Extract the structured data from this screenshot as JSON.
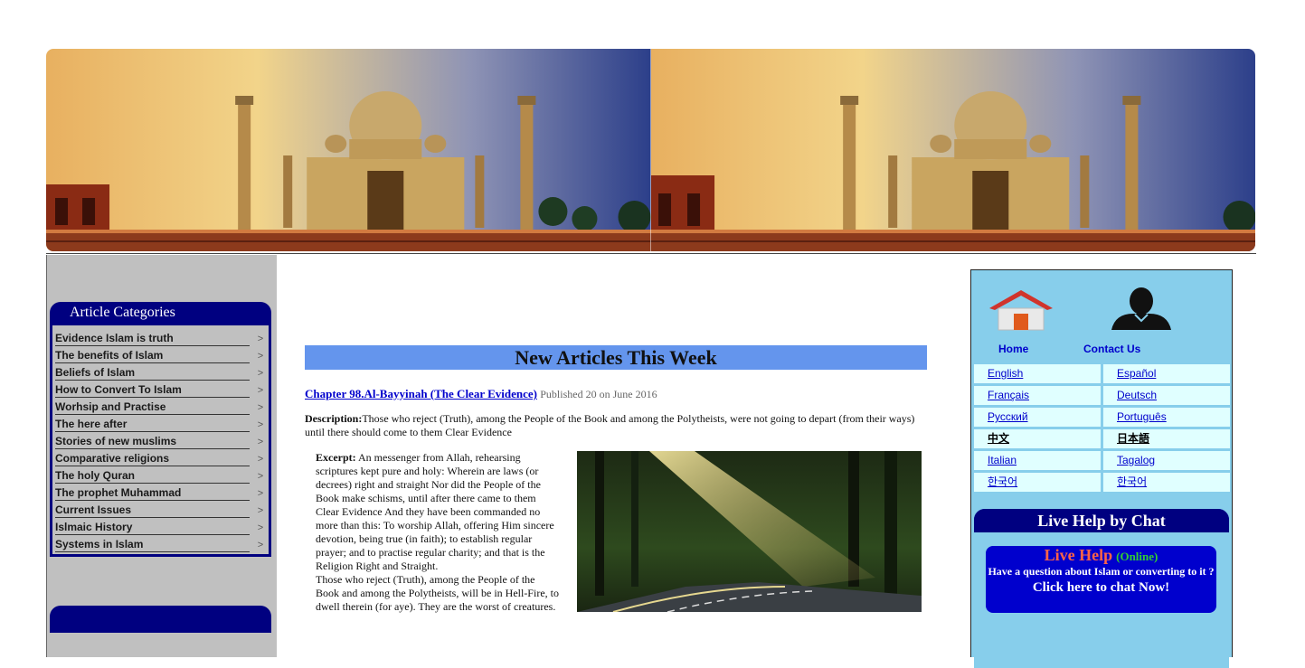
{
  "left_categories": {
    "title": "Article Categories",
    "items": [
      {
        "label": "Evidence Islam is truth"
      },
      {
        "label": "The benefits of Islam"
      },
      {
        "label": "Beliefs of Islam"
      },
      {
        "label": "How to Convert To Islam"
      },
      {
        "label": "Worhsip and Practise"
      },
      {
        "label": "The here after"
      },
      {
        "label": "Stories of new muslims"
      },
      {
        "label": "Comparative religions"
      },
      {
        "label": "The holy Quran"
      },
      {
        "label": "The prophet Muhammad"
      },
      {
        "label": "Current Issues"
      },
      {
        "label": "Islmaic History"
      },
      {
        "label": "Systems in Islam"
      }
    ],
    "arrow": ">"
  },
  "main": {
    "heading": "New Articles This Week",
    "article": {
      "title": "Chapter 98.Al-Bayyinah (The Clear Evidence)",
      "published": "Published 20 on June 2016",
      "description_label": "Description:",
      "description": "Those who reject (Truth), among the People of the Book and among the Polytheists, were not going to depart (from their ways) until there should come to them Clear Evidence",
      "excerpt_label": "Excerpt:",
      "excerpt_p1": "An messenger from Allah, rehearsing scriptures kept pure and holy: Wherein are laws (or decrees) right and straight Nor did the People of the Book make schisms, until after there came to them Clear Evidence And they have been commanded no more than this: To worship Allah, offering Him sincere devotion, being true (in faith); to establish regular prayer; and to practise regular charity; and that is the Religion Right and Straight.",
      "excerpt_p2": "Those who reject (Truth), among the People of the Book and among the Polytheists, will be in Hell-Fire, to dwell therein (for aye). They are the worst of creatures."
    }
  },
  "right_panel": {
    "home_label": "Home",
    "contact_label": "Contact Us",
    "languages": [
      {
        "label": "English",
        "bold": false
      },
      {
        "label": "Español",
        "bold": false
      },
      {
        "label": "Français",
        "bold": false
      },
      {
        "label": "Deutsch",
        "bold": false
      },
      {
        "label": "Русский",
        "bold": false
      },
      {
        "label": "Português",
        "bold": false
      },
      {
        "label": "中文",
        "bold": true
      },
      {
        "label": "日本語",
        "bold": true
      },
      {
        "label": "Italian",
        "bold": false
      },
      {
        "label": "Tagalog",
        "bold": false
      },
      {
        "label": "한국어",
        "bold": false
      },
      {
        "label": "한국어",
        "bold": false
      }
    ],
    "chat": {
      "title": "Live Help by Chat",
      "live_label": "Live Help",
      "status": "(Online)",
      "question": "Have a question about Islam or converting to it ?",
      "cta": "Click here to chat Now!"
    }
  },
  "colors": {
    "nav_dark": "#000080",
    "heading_bar": "#6495ed",
    "right_panel": "#87ceeb",
    "lang_cell": "#e0ffff",
    "live_help": "#ff6347",
    "online": "#32cd32"
  }
}
